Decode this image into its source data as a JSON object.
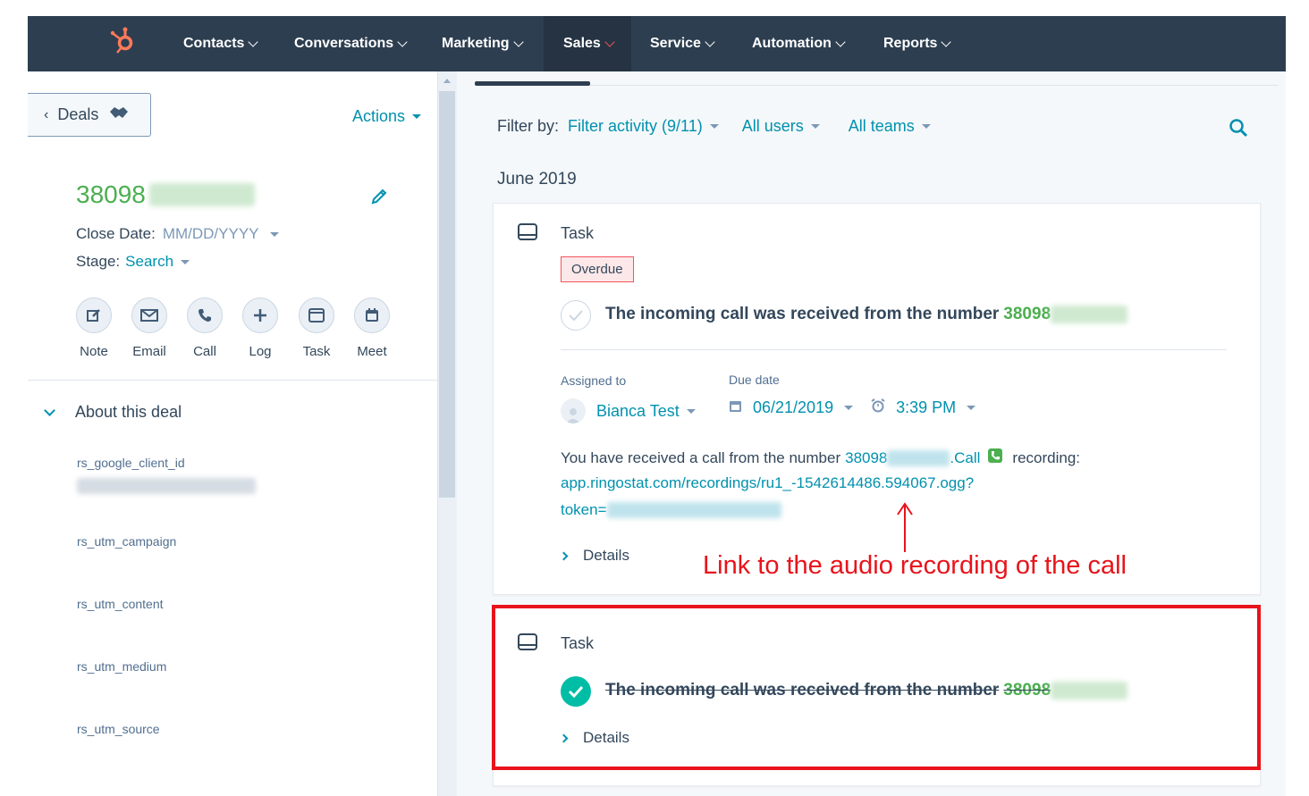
{
  "nav": {
    "items": [
      {
        "label": "Contacts"
      },
      {
        "label": "Conversations"
      },
      {
        "label": "Marketing"
      },
      {
        "label": "Sales"
      },
      {
        "label": "Service"
      },
      {
        "label": "Automation"
      },
      {
        "label": "Reports"
      }
    ],
    "active": "Sales"
  },
  "left": {
    "back_label": "Deals",
    "actions_label": "Actions",
    "deal_name": "38098",
    "close_date_label": "Close Date:",
    "close_date_value": "MM/DD/YYYY",
    "stage_label": "Stage:",
    "stage_value": "Search",
    "activity_buttons": [
      {
        "label": "Note",
        "icon": "note-icon"
      },
      {
        "label": "Email",
        "icon": "email-icon"
      },
      {
        "label": "Call",
        "icon": "call-icon"
      },
      {
        "label": "Log",
        "icon": "plus-icon"
      },
      {
        "label": "Task",
        "icon": "task-icon"
      },
      {
        "label": "Meet",
        "icon": "calendar-icon"
      }
    ],
    "about_title": "About this deal",
    "fields": [
      {
        "label": "rs_google_client_id"
      },
      {
        "label": "rs_utm_campaign"
      },
      {
        "label": "rs_utm_content"
      },
      {
        "label": "rs_utm_medium"
      },
      {
        "label": "rs_utm_source"
      }
    ]
  },
  "timeline": {
    "filter_label": "Filter by:",
    "filter_activity": "Filter activity (9/11)",
    "filter_users": "All users",
    "filter_teams": "All teams",
    "month": "June 2019",
    "task1": {
      "type": "Task",
      "badge": "Overdue",
      "text": "The incoming call was received from the number",
      "number": "38098",
      "assigned_label": "Assigned to",
      "assignee": "Bianca Test",
      "due_label": "Due date",
      "due_date": "06/21/2019",
      "due_time": "3:39 PM",
      "body_prefix": "You have received a call from the number",
      "body_number": "38098",
      "body_call": ".Call",
      "body_recording": "recording:",
      "link_line1": "app.ringostat.com/recordings/ru1_-1542614486.594067.ogg?",
      "link_line2": "token=",
      "details": "Details"
    },
    "task2": {
      "type": "Task",
      "text": "The incoming call was received from the number",
      "number": "38098",
      "details": "Details"
    }
  },
  "annotation": {
    "text": "Link to the audio recording of the call",
    "color": "#e8131b"
  },
  "colors": {
    "nav_bg": "#2d3e50",
    "accent": "#0091ae",
    "brand": "#ff7a59",
    "green": "#4caf50",
    "done": "#00bda5"
  }
}
